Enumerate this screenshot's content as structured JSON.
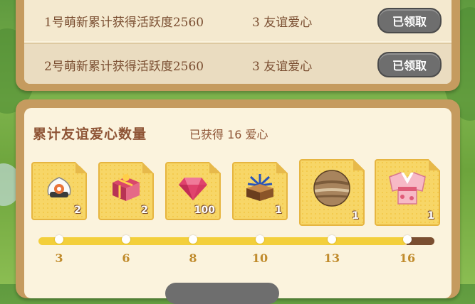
{
  "tasks": [
    {
      "description": "1号萌新累计获得活跃度2560",
      "reward": "3 友谊爱心",
      "button_label": "已领取"
    },
    {
      "description": "2号萌新累计获得活跃度2560",
      "reward": "3 友谊爱心",
      "button_label": "已领取"
    }
  ],
  "section": {
    "title": "累计友谊爱心数量",
    "obtained": "已获得 16 爱心"
  },
  "rewards": [
    {
      "icon": "rice-ball-icon",
      "count": "2"
    },
    {
      "icon": "gift-box-icon",
      "count": "2"
    },
    {
      "icon": "gem-icon",
      "count": "100"
    },
    {
      "icon": "firework-box-icon",
      "count": "1"
    },
    {
      "icon": "planet-ball-icon",
      "count": "1"
    },
    {
      "icon": "kimono-icon",
      "count": "1"
    }
  ],
  "progress": {
    "current": 16,
    "fraction": 0.93,
    "milestones": [
      "3",
      "6",
      "8",
      "10",
      "13",
      "16"
    ]
  },
  "colors": {
    "panel_border": "#c59b5f",
    "panel_bg": "#fbf3dd",
    "text_brown": "#7a4e31",
    "title_brown": "#8e5435",
    "milestone_text": "#c08b2c",
    "claimed_button": "#6e6e6e",
    "card_yellow": "#f7d667"
  }
}
